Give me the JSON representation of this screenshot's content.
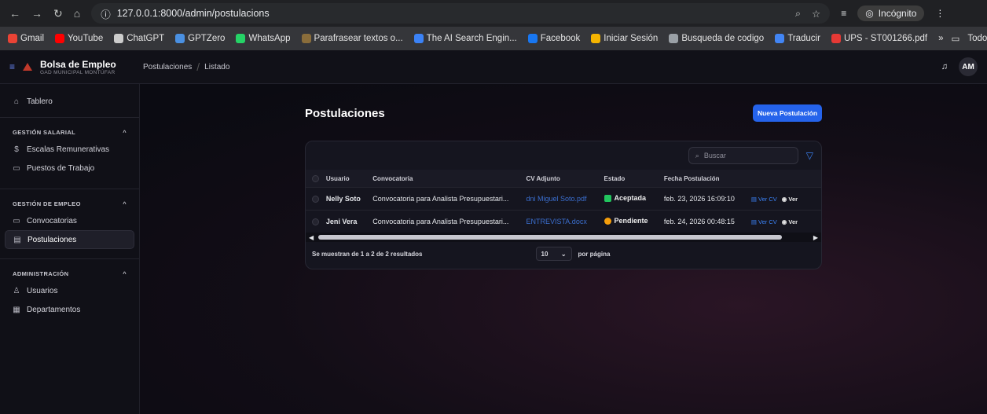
{
  "browser": {
    "url": "127.0.0.1:8000/admin/postulacions",
    "incognito_label": "Incógnito",
    "bookmarks": [
      {
        "label": "Gmail",
        "color": "#ea4335"
      },
      {
        "label": "YouTube",
        "color": "#ff0000"
      },
      {
        "label": "ChatGPT",
        "color": "#cccccc"
      },
      {
        "label": "GPTZero",
        "color": "#4a90e2"
      },
      {
        "label": "WhatsApp",
        "color": "#25d366"
      },
      {
        "label": "Parafrasear textos o...",
        "color": "#8a6d3b"
      },
      {
        "label": "The AI Search Engin...",
        "color": "#3b82f6"
      },
      {
        "label": "Facebook",
        "color": "#1877f2"
      },
      {
        "label": "Iniciar Sesión",
        "color": "#f5b400"
      },
      {
        "label": "Busqueda de codigo",
        "color": "#9aa0a6"
      },
      {
        "label": "Traducir",
        "color": "#4285f4"
      },
      {
        "label": "UPS - ST001266.pdf",
        "color": "#e53935"
      }
    ],
    "all_bookmarks": "Todos los marcadores"
  },
  "app": {
    "brand_title": "Bolsa de Empleo",
    "brand_sub": "GAD MUNICIPAL MONTÚFAR",
    "crumb1": "Postulaciones",
    "crumb2": "Listado",
    "avatar": "AM"
  },
  "sidebar": {
    "tablero": "Tablero",
    "group1": "GESTIÓN SALARIAL",
    "escalas": "Escalas Remunerativas",
    "puestos": "Puestos de Trabajo",
    "group2": "GESTIÓN DE EMPLEO",
    "convocatorias": "Convocatorias",
    "postulaciones": "Postulaciones",
    "group3": "ADMINISTRACIÓN",
    "usuarios": "Usuarios",
    "departamentos": "Departamentos"
  },
  "main": {
    "title": "Postulaciones",
    "new_button": "Nueva Postulación",
    "search_placeholder": "Buscar",
    "columns": [
      "Usuario",
      "Convocatoria",
      "CV Adjunto",
      "Estado",
      "Fecha Postulación"
    ],
    "rows": [
      {
        "usuario": "Nelly Soto",
        "convocatoria": "Convocatoria para Analista Presupuestari...",
        "cv": "dni Miguel Soto.pdf",
        "estado": "Aceptada",
        "fecha": "feb. 23, 2026 16:09:10",
        "ver_cv": "Ver CV",
        "ver": "Ver"
      },
      {
        "usuario": "Jeni Vera",
        "convocatoria": "Convocatoria para Analista Presupuestari...",
        "cv": "ENTREVISTA.docx",
        "estado": "Pendiente",
        "fecha": "feb. 24, 2026 00:48:15",
        "ver_cv": "Ver CV",
        "ver": "Ver"
      }
    ],
    "results_text": "Se muestran de 1 a 2 de 2 resultados",
    "per_page_value": "10",
    "per_page_label": "por página"
  }
}
